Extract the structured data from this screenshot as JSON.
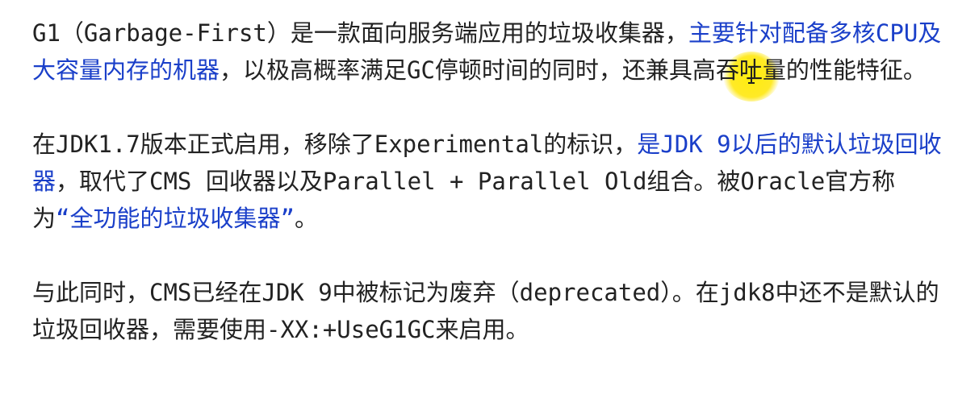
{
  "paragraphs": [
    {
      "segments": [
        {
          "text": "G1（Garbage-First）是一款面向服务端应用的垃圾收集器，",
          "highlight": false
        },
        {
          "text": "主要针对配备多核CPU及大容量内存的机器",
          "highlight": true
        },
        {
          "text": "，以极高概率满足GC停顿时间的同时，还兼具高吞吐量的性能特征。",
          "highlight": false
        }
      ]
    },
    {
      "segments": [
        {
          "text": "在JDK1.7版本正式启用，移除了Experimental的标识，",
          "highlight": false
        },
        {
          "text": "是JDK 9以后的默认垃圾回收器",
          "highlight": true
        },
        {
          "text": "，取代了CMS 回收器以及Parallel + Parallel Old组合。被Oracle官方称为",
          "highlight": false
        },
        {
          "text": "“全功能的垃圾收集器”",
          "highlight": true
        },
        {
          "text": "。",
          "highlight": false
        }
      ]
    },
    {
      "segments": [
        {
          "text": "与此同时，CMS已经在JDK 9中被标记为废弃（deprecated）。在jdk8中还不是默认的垃圾回收器，需要使用-XX:+UseG1GC来启用。",
          "highlight": false
        }
      ]
    }
  ],
  "colors": {
    "text": "#222222",
    "highlight": "#1a3fc9",
    "cursor_halo": "#ffe600"
  }
}
